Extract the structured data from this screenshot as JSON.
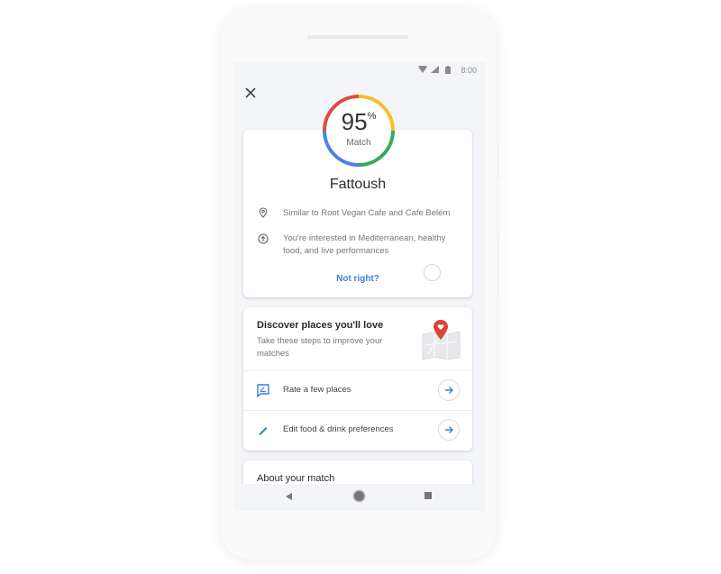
{
  "status_bar": {
    "time": "8:00",
    "icons": [
      "wifi-icon",
      "signal-icon",
      "battery-icon"
    ]
  },
  "header": {
    "close_icon": "close-icon"
  },
  "match": {
    "percent": "95",
    "percent_sign": "%",
    "label": "Match",
    "ring_colors": {
      "red": "#e04a3f",
      "yellow": "#f4bf2f",
      "green": "#3aa85a",
      "blue": "#4a81e6"
    }
  },
  "place": {
    "name": "Fattoush",
    "reasons": [
      {
        "icon": "location-pin-icon",
        "text": "Similar to Root Vegan Cafe and Cafe Belém"
      },
      {
        "icon": "trending-up-icon",
        "text": "You're interested in Mediterranean, healthy food, and live performances"
      }
    ],
    "not_right_label": "Not right?"
  },
  "discover": {
    "title": "Discover places you'll love",
    "subtitle": "Take these steps to improve your matches",
    "illustration": "map-with-heart-pin-icon",
    "actions": [
      {
        "icon": "rate-review-icon",
        "label": "Rate a few places"
      },
      {
        "icon": "pencil-icon",
        "label": "Edit food & drink preferences"
      }
    ]
  },
  "about": {
    "title": "About your match"
  },
  "nav_bar": {
    "back": "back-icon",
    "home": "home-icon",
    "recents": "recents-icon"
  },
  "colors": {
    "accent": "#3d7fd9",
    "pin": "#d9453a"
  }
}
